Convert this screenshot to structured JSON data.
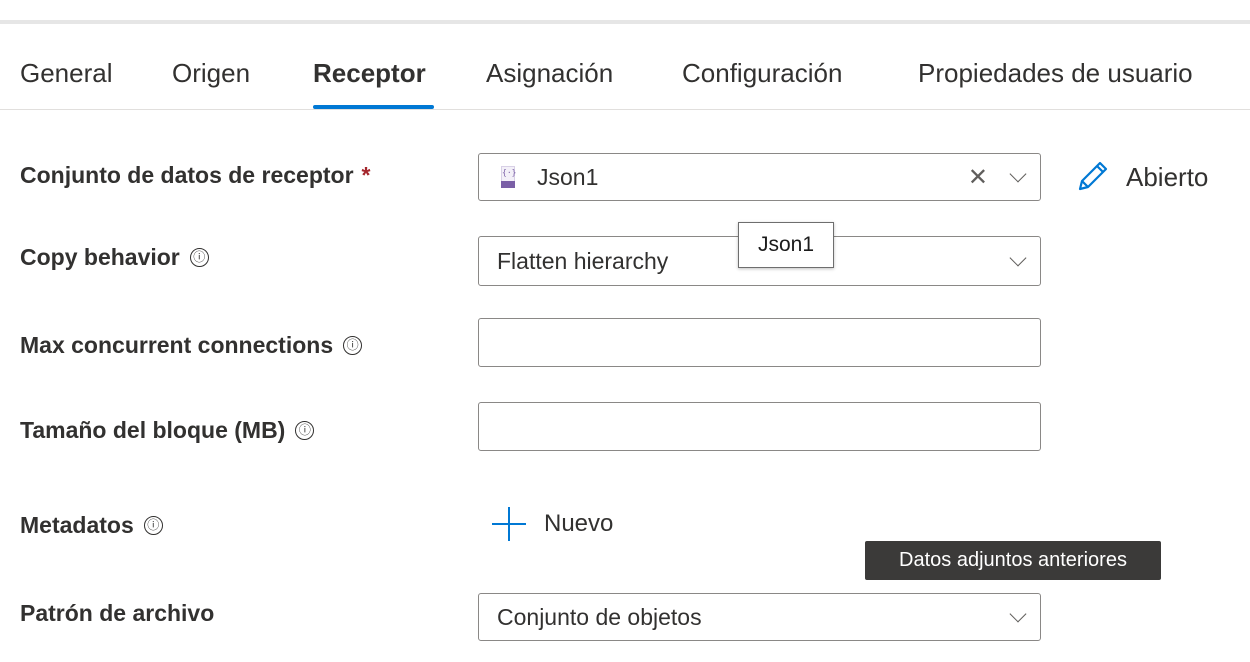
{
  "tabs": [
    {
      "label": "General"
    },
    {
      "label": "Origen"
    },
    {
      "label": "Receptor"
    },
    {
      "label": "Asignación"
    },
    {
      "label": "Configuración"
    },
    {
      "label": "Propiedades de usuario"
    }
  ],
  "active_tab": "Receptor",
  "form": {
    "sink_dataset": {
      "label": "Conjunto de datos de receptor",
      "required_mark": "*",
      "value": "Json1",
      "clear_icon": "clear-x-icon",
      "open_label": "Abierto",
      "tooltip": "Json1"
    },
    "copy_behavior": {
      "label": "Copy behavior",
      "info_glyph": "ⓘ",
      "value": "Flatten hierarchy"
    },
    "max_connections": {
      "label": "Max concurrent connections",
      "info_glyph": "ⓘ",
      "value": ""
    },
    "block_size": {
      "label": "Tamaño del bloque (MB)",
      "info_glyph": "ⓘ",
      "value": ""
    },
    "metadata": {
      "label": "Metadatos",
      "info_glyph": "ⓘ",
      "new_label": "Nuevo",
      "tooltip": "Datos adjuntos anteriores"
    },
    "file_pattern": {
      "label": "Patrón de archivo",
      "value": "Conjunto de objetos"
    }
  },
  "colors": {
    "accent": "#0078d4",
    "required": "#a4262c",
    "tooltip_dark_bg": "#3b3a39"
  }
}
